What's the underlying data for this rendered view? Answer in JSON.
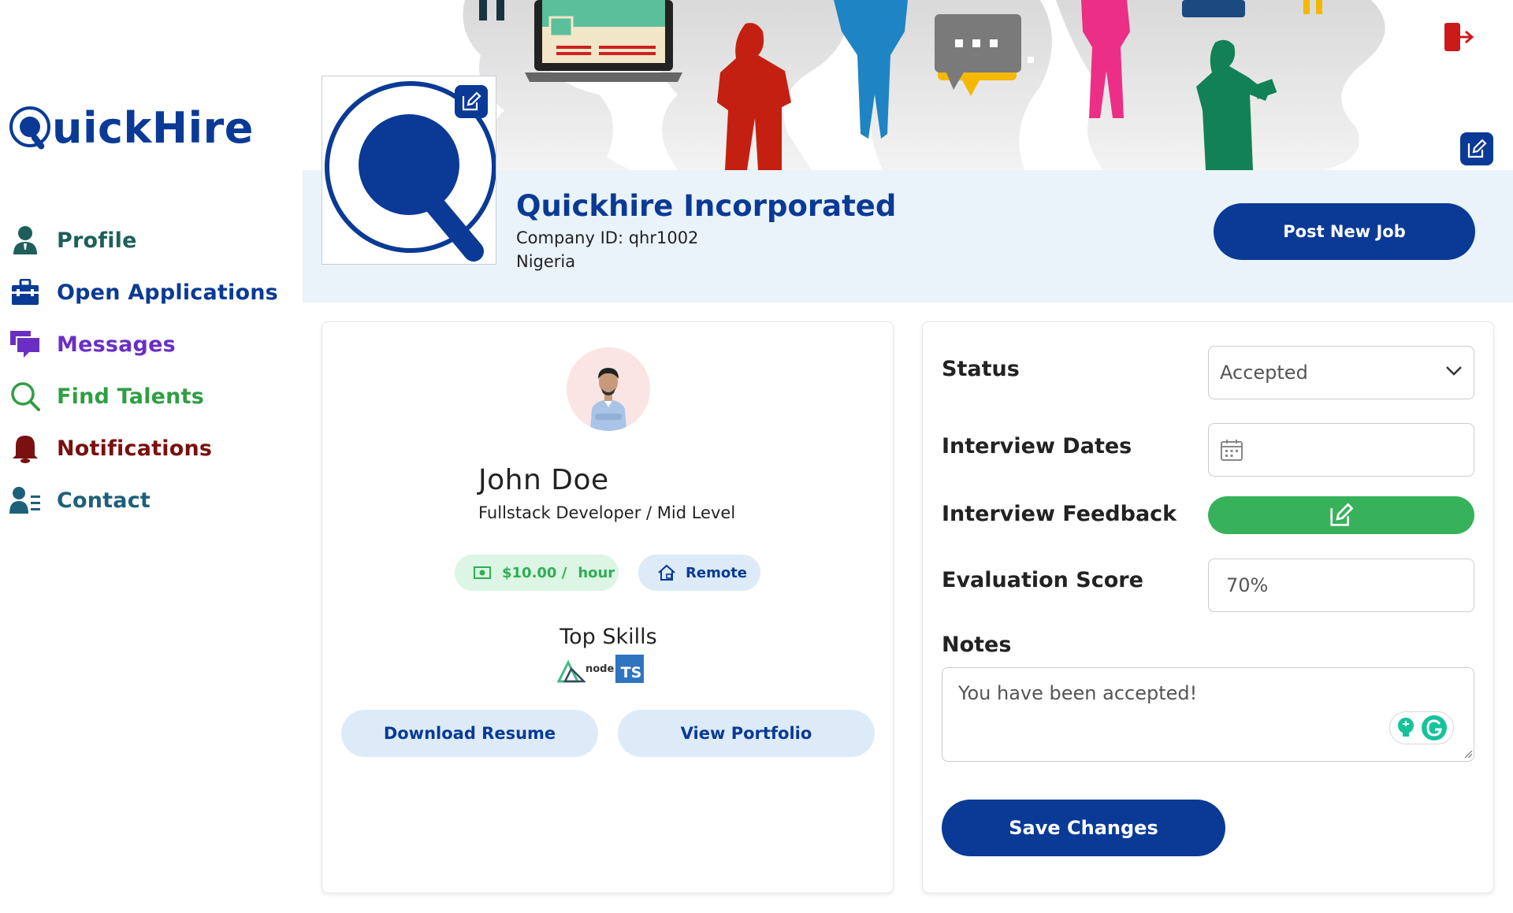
{
  "brand": {
    "name_rest": "uickHire",
    "color": "#0a3a96"
  },
  "nav": {
    "items": [
      {
        "label": "Profile",
        "icon": "user-icon",
        "color": "#1e5f5a"
      },
      {
        "label": "Open Applications",
        "icon": "briefcase-icon",
        "color": "#0a3a96"
      },
      {
        "label": "Messages",
        "icon": "chat-bubbles-icon",
        "color": "#6a2fc2"
      },
      {
        "label": "Find Talents",
        "icon": "search-icon",
        "color": "#2f9e44"
      },
      {
        "label": "Notifications",
        "icon": "bell-icon",
        "color": "#7a1010"
      },
      {
        "label": "Contact",
        "icon": "contact-list-icon",
        "color": "#1e5f7a"
      }
    ]
  },
  "header": {
    "logout_icon": "logout-icon",
    "logout_color": "#cc1a1a",
    "banner_edit_icon": "edit-icon"
  },
  "company": {
    "name": "Quickhire Incorporated",
    "id_line": "Company ID: qhr1002",
    "country": "Nigeria",
    "logo_edit_icon": "edit-icon",
    "post_job_label": "Post New Job"
  },
  "candidate": {
    "name": "John Doe",
    "role": "Fullstack Developer / Mid Level",
    "rate": "$10.00 /",
    "rate_unit": "hour",
    "work_mode": "Remote",
    "skills_title": "Top Skills",
    "skills": [
      "vue-icon",
      "nodejs-icon",
      "typescript-icon"
    ],
    "skill_node_text": "node",
    "skill_ts_text": "TS",
    "download_resume_label": "Download Resume",
    "view_portfolio_label": "View Portfolio"
  },
  "application": {
    "status_label": "Status",
    "status_value": "Accepted",
    "interview_dates_label": "Interview Dates",
    "interview_dates_value": "",
    "interview_feedback_label": "Interview Feedback",
    "feedback_color": "#37b15a",
    "evaluation_score_label": "Evaluation Score",
    "evaluation_score_value": "70%",
    "notes_label": "Notes",
    "notes_value": "You have been accepted!",
    "save_label": "Save Changes"
  }
}
